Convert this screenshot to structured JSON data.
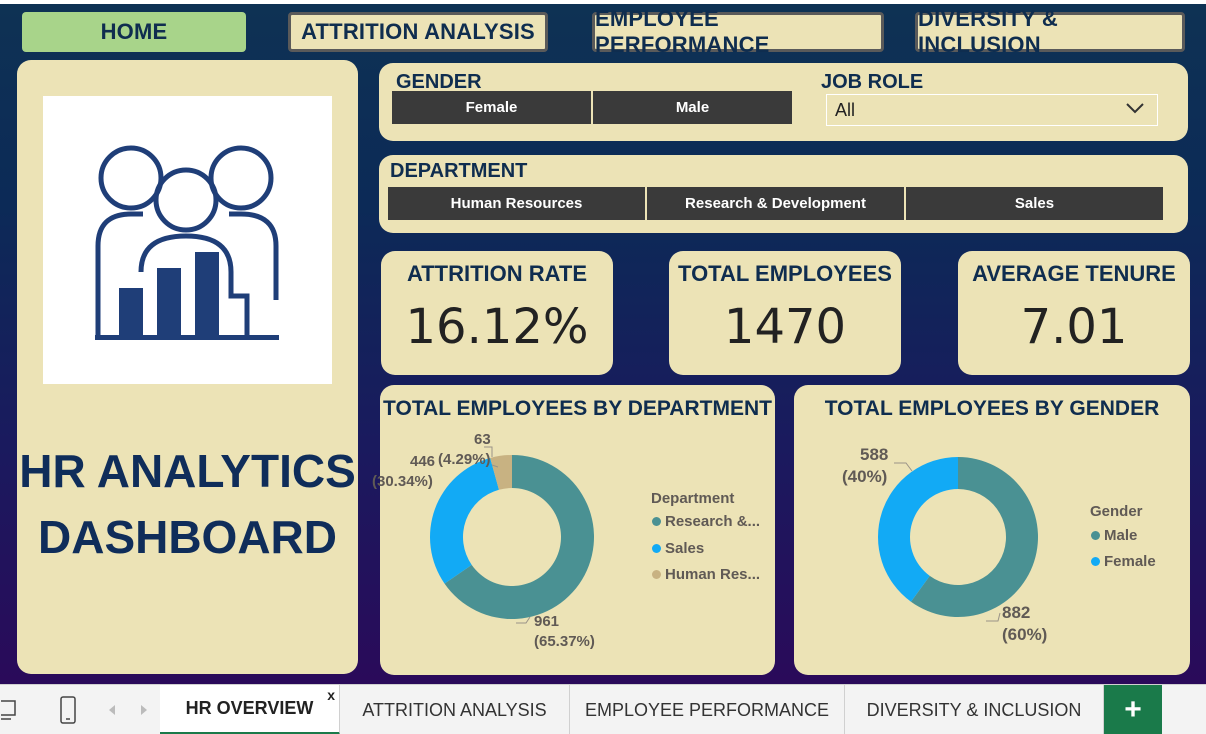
{
  "nav": {
    "home": "HOME",
    "attrition": "ATTRITION ANALYSIS",
    "performance": "EMPLOYEE PERFORMANCE",
    "diversity": "DIVERSITY & INCLUSION"
  },
  "left": {
    "title_line1": "HR ANALYTICS",
    "title_line2": "DASHBOARD",
    "logo_icon": "team-analytics-icon"
  },
  "filters": {
    "gender_label": "GENDER",
    "gender_options": [
      "Female",
      "Male"
    ],
    "jobrole_label": "JOB ROLE",
    "jobrole_value": "All",
    "department_label": "DEPARTMENT",
    "department_options": [
      "Human Resources",
      "Research & Development",
      "Sales"
    ]
  },
  "kpis": [
    {
      "title": "ATTRITION RATE",
      "value": "16.12%"
    },
    {
      "title": "TOTAL EMPLOYEES",
      "value": "1470"
    },
    {
      "title": "AVERAGE TENURE",
      "value": "7.01"
    }
  ],
  "colors": {
    "teal": "#4a9193",
    "blue": "#12aaf5",
    "tan": "#c8b282",
    "panel": "#ece3b6",
    "navy": "#0f2d4f",
    "excel_green": "#1a7a4a"
  },
  "chart_data": [
    {
      "type": "pie",
      "title": "TOTAL EMPLOYEES BY DEPARTMENT",
      "legend_title": "Department",
      "legend_placement": "right",
      "categories": [
        "Research &...",
        "Sales",
        "Human Res..."
      ],
      "values": [
        961,
        446,
        63
      ],
      "labels": [
        {
          "count": "961",
          "pct": "(65.37%)"
        },
        {
          "count": "446",
          "pct": "(30.34%)"
        },
        {
          "count": "63",
          "pct": "(4.29%)"
        }
      ],
      "colors": [
        "#4a9193",
        "#12aaf5",
        "#c8b282"
      ]
    },
    {
      "type": "pie",
      "title": "TOTAL EMPLOYEES BY GENDER",
      "legend_title": "Gender",
      "legend_placement": "right",
      "categories": [
        "Male",
        "Female"
      ],
      "values": [
        882,
        588
      ],
      "labels": [
        {
          "count": "882",
          "pct": "(60%)"
        },
        {
          "count": "588",
          "pct": "(40%)"
        }
      ],
      "colors": [
        "#4a9193",
        "#12aaf5"
      ]
    }
  ],
  "tabs": {
    "items": [
      "HR OVERVIEW",
      "ATTRITION ANALYSIS",
      "EMPLOYEE PERFORMANCE",
      "DIVERSITY & INCLUSION"
    ],
    "close": "x",
    "add": "+"
  }
}
